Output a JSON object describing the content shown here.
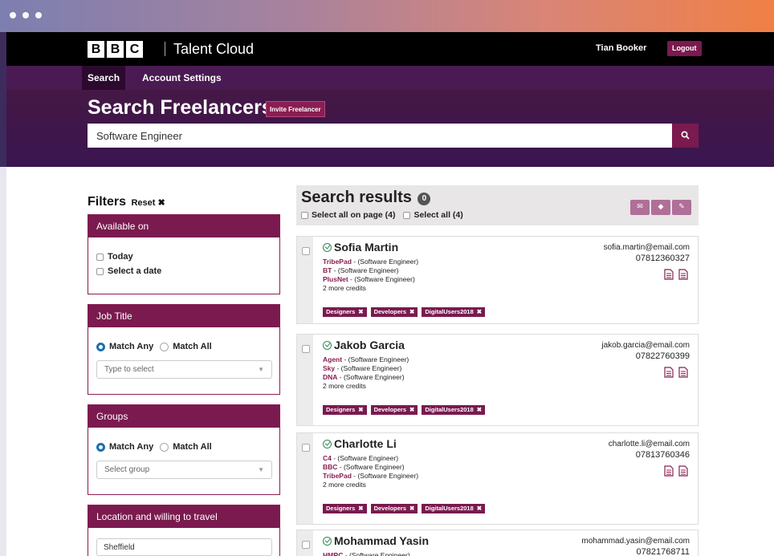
{
  "brand": {
    "letters": [
      "B",
      "B",
      "C"
    ],
    "name": "Talent Cloud"
  },
  "user": {
    "name": "Tian Booker",
    "logout_label": "Logout"
  },
  "nav": {
    "items": [
      "Search",
      "Account Settings"
    ]
  },
  "hero": {
    "title": "Search Freelancers",
    "invite_label": "Invite Freelancer",
    "search_value": "Software Engineer"
  },
  "filters": {
    "title": "Filters",
    "reset_label": "Reset",
    "available": {
      "title": "Available on",
      "options": [
        "Today",
        "Select a date"
      ]
    },
    "job_title": {
      "title": "Job Title",
      "match_any": "Match Any",
      "match_all": "Match All",
      "placeholder": "Type to select"
    },
    "groups": {
      "title": "Groups",
      "match_any": "Match Any",
      "match_all": "Match All",
      "placeholder": "Select group"
    },
    "location": {
      "title": "Location and willing to travel",
      "value": "Sheffield"
    }
  },
  "results": {
    "title": "Search results",
    "count": "0",
    "select_page": "Select all on page (4)",
    "select_all": "Select all (4)",
    "items": [
      {
        "name": "Sofia Martin",
        "email": "sofia.martin@email.com",
        "phone": "07812360327",
        "credits": [
          {
            "company": "TribePad",
            "role": " - (Software Engineer)"
          },
          {
            "company": "BT",
            "role": " - (Software Engineer)"
          },
          {
            "company": "PlusNet",
            "role": " - (Software Engineer)"
          }
        ],
        "more": "2 more credits",
        "tags": [
          "Designers",
          "Developers",
          "DigitalUsers2018"
        ]
      },
      {
        "name": "Jakob Garcia",
        "email": "jakob.garcia@email.com",
        "phone": "07822760399",
        "credits": [
          {
            "company": "Agent",
            "role": " - (Software Engineer)"
          },
          {
            "company": "Sky",
            "role": " - (Software Engineer)"
          },
          {
            "company": "DNA",
            "role": " - (Software Engineer)"
          }
        ],
        "more": "2 more credits",
        "tags": [
          "Designers",
          "Developers",
          "DigitalUsers2018"
        ]
      },
      {
        "name": "Charlotte Li",
        "email": "charlotte.li@email.com",
        "phone": "07813760346",
        "credits": [
          {
            "company": "C4",
            "role": " - (Software Engineer)"
          },
          {
            "company": "BBC",
            "role": " - (Software Engineer)"
          },
          {
            "company": "TribePad",
            "role": " - (Software Engineer)"
          }
        ],
        "more": "2 more credits",
        "tags": [
          "Designers",
          "Developers",
          "DigitalUsers2018"
        ]
      },
      {
        "name": "Mohammad Yasin",
        "email": "mohammad.yasin@email.com",
        "phone": "07821768711",
        "credits": [
          {
            "company": "HMRC",
            "role": " - (Software Engineer)"
          }
        ],
        "more": "",
        "tags": []
      }
    ]
  },
  "colors": {
    "brand": "#7a1a4f",
    "header": "#000000",
    "hero": "#3f1650",
    "verified": "#2e8b57"
  }
}
